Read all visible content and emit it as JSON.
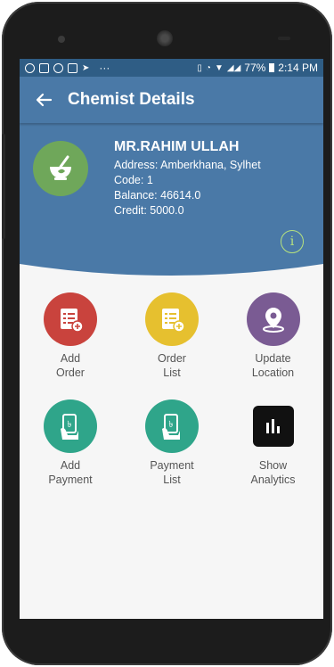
{
  "status_bar": {
    "battery": "77%",
    "time": "2:14 PM"
  },
  "app_bar": {
    "back_icon": "arrow-left-icon",
    "title": "Chemist Details"
  },
  "chemist": {
    "name": "MR.RAHIM ULLAH",
    "address": "Address: Amberkhana, Sylhet",
    "code": "Code: 1",
    "balance": "Balance: 46614.0",
    "credit": "Credit: 5000.0",
    "avatar_icon": "mortar-pestle-icon"
  },
  "actions": [
    {
      "id": "add-order",
      "label": "Add\nOrder",
      "icon": "order-add-icon",
      "color": "#c9433d"
    },
    {
      "id": "order-list",
      "label": "Order\nList",
      "icon": "order-list-icon",
      "color": "#e6c02f"
    },
    {
      "id": "update-location",
      "label": "Update\nLocation",
      "icon": "location-pin-icon",
      "color": "#7a5b93"
    },
    {
      "id": "add-payment",
      "label": "Add\nPayment",
      "icon": "payment-hand-icon",
      "color": "#2fa58a"
    },
    {
      "id": "payment-list",
      "label": "Payment\nList",
      "icon": "payment-hand-icon",
      "color": "#2fa58a"
    },
    {
      "id": "show-analytics",
      "label": "Show\nAnalytics",
      "icon": "bar-chart-icon",
      "color": "#111111"
    }
  ],
  "colors": {
    "status_bar": "#2f5d85",
    "app_bar": "#4a79a7",
    "header": "#4a79a7",
    "info_icon": "#b7e27e"
  }
}
